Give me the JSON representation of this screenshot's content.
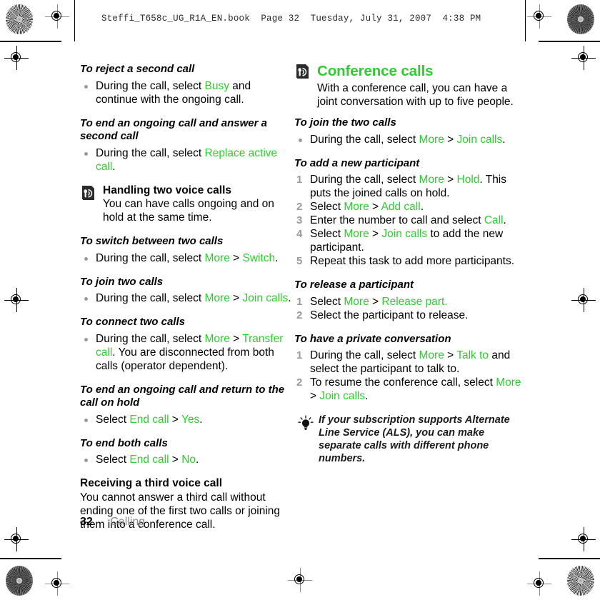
{
  "theme": {
    "accent_green": "#2ECC2E",
    "muted_gray": "#9A9A9A",
    "footer_gray": "#8A8A8A"
  },
  "header": {
    "slug": "Steffi_T658c_UG_R1A_EN.book  Page 32  Tuesday, July 31, 2007  4:38 PM"
  },
  "footer": {
    "page_number": "32",
    "chapter": "Calling"
  },
  "left_column": {
    "blocks": [
      {
        "task_heading": "To reject a second call",
        "bullets": [
          [
            {
              "t": "During the call, select ",
              "c": "black"
            },
            {
              "t": "Busy",
              "c": "green"
            },
            {
              "t": " and continue with the ongoing call.",
              "c": "black"
            }
          ]
        ]
      },
      {
        "task_heading": "To end an ongoing call and answer a second call",
        "bullets": [
          [
            {
              "t": "During the call, select ",
              "c": "black"
            },
            {
              "t": "Replace active call",
              "c": "green"
            },
            {
              "t": ".",
              "c": "black"
            }
          ]
        ]
      },
      {
        "icon": "phone-signal-icon",
        "sub_heading": "Handling two voice calls",
        "paragraph": "You can have calls ongoing and on hold at the same time."
      },
      {
        "task_heading": "To switch between two calls",
        "bullets": [
          [
            {
              "t": "During the call, select ",
              "c": "black"
            },
            {
              "t": "More",
              "c": "green"
            },
            {
              "t": " > ",
              "c": "black"
            },
            {
              "t": "Switch",
              "c": "green"
            },
            {
              "t": ".",
              "c": "black"
            }
          ]
        ]
      },
      {
        "task_heading": "To join two calls",
        "bullets": [
          [
            {
              "t": "During the call, select ",
              "c": "black"
            },
            {
              "t": "More",
              "c": "green"
            },
            {
              "t": " > ",
              "c": "black"
            },
            {
              "t": "Join calls",
              "c": "green"
            },
            {
              "t": ".",
              "c": "black"
            }
          ]
        ]
      },
      {
        "task_heading": "To connect two calls",
        "bullets": [
          [
            {
              "t": "During the call, select ",
              "c": "black"
            },
            {
              "t": "More",
              "c": "green"
            },
            {
              "t": " > ",
              "c": "black"
            },
            {
              "t": "Transfer call",
              "c": "green"
            },
            {
              "t": ". You are disconnected from both calls (operator dependent).",
              "c": "black"
            }
          ]
        ]
      },
      {
        "task_heading": "To end an ongoing call and return to the call on hold",
        "bullets": [
          [
            {
              "t": "Select ",
              "c": "black"
            },
            {
              "t": "End call",
              "c": "green"
            },
            {
              "t": " > ",
              "c": "black"
            },
            {
              "t": "Yes",
              "c": "green"
            },
            {
              "t": ".",
              "c": "black"
            }
          ]
        ]
      },
      {
        "task_heading": "To end both calls",
        "bullets": [
          [
            {
              "t": "Select ",
              "c": "black"
            },
            {
              "t": "End call",
              "c": "green"
            },
            {
              "t": " > ",
              "c": "black"
            },
            {
              "t": "No",
              "c": "green"
            },
            {
              "t": ".",
              "c": "black"
            }
          ]
        ]
      },
      {
        "sub_heading": "Receiving a third voice call",
        "paragraph": "You cannot answer a third call without ending one of the first two calls or joining them into a conference call."
      }
    ]
  },
  "right_column": {
    "section_icon": "phone-signal-icon",
    "section_title": "Conference calls",
    "section_intro": "With a conference call, you can have a joint conversation with up to five people.",
    "blocks": [
      {
        "task_heading": "To join the two calls",
        "list_type": "bullet",
        "items": [
          [
            {
              "t": "During the call, select ",
              "c": "black"
            },
            {
              "t": "More",
              "c": "green"
            },
            {
              "t": " > ",
              "c": "black"
            },
            {
              "t": "Join calls",
              "c": "green"
            },
            {
              "t": ".",
              "c": "black"
            }
          ]
        ]
      },
      {
        "task_heading": "To add a new participant",
        "list_type": "number",
        "items": [
          [
            {
              "t": "During the call, select ",
              "c": "black"
            },
            {
              "t": "More",
              "c": "green"
            },
            {
              "t": " > ",
              "c": "black"
            },
            {
              "t": "Hold",
              "c": "green"
            },
            {
              "t": ". This puts the joined calls on hold.",
              "c": "black"
            }
          ],
          [
            {
              "t": "Select ",
              "c": "black"
            },
            {
              "t": "More",
              "c": "green"
            },
            {
              "t": " > ",
              "c": "black"
            },
            {
              "t": "Add call",
              "c": "green"
            },
            {
              "t": ".",
              "c": "black"
            }
          ],
          [
            {
              "t": "Enter the number to call and select ",
              "c": "black"
            },
            {
              "t": "Call",
              "c": "green"
            },
            {
              "t": ".",
              "c": "black"
            }
          ],
          [
            {
              "t": "Select ",
              "c": "black"
            },
            {
              "t": "More",
              "c": "green"
            },
            {
              "t": " > ",
              "c": "black"
            },
            {
              "t": "Join calls",
              "c": "green"
            },
            {
              "t": " to add the new participant.",
              "c": "black"
            }
          ],
          [
            {
              "t": "Repeat this task to add more participants.",
              "c": "black"
            }
          ]
        ]
      },
      {
        "task_heading": "To release a participant",
        "list_type": "number",
        "items": [
          [
            {
              "t": "Select ",
              "c": "black"
            },
            {
              "t": "More",
              "c": "green"
            },
            {
              "t": " > ",
              "c": "black"
            },
            {
              "t": "Release part.",
              "c": "green"
            }
          ],
          [
            {
              "t": "Select the participant to release.",
              "c": "black"
            }
          ]
        ]
      },
      {
        "task_heading": "To have a private conversation",
        "list_type": "number",
        "items": [
          [
            {
              "t": "During the call, select ",
              "c": "black"
            },
            {
              "t": "More",
              "c": "green"
            },
            {
              "t": " > ",
              "c": "black"
            },
            {
              "t": "Talk to",
              "c": "green"
            },
            {
              "t": " and select the participant to talk to.",
              "c": "black"
            }
          ],
          [
            {
              "t": "To resume the conference call, select ",
              "c": "black"
            },
            {
              "t": "More",
              "c": "green"
            },
            {
              "t": " > ",
              "c": "black"
            },
            {
              "t": "Join calls",
              "c": "green"
            },
            {
              "t": ".",
              "c": "black"
            }
          ]
        ]
      }
    ],
    "tip": {
      "icon": "lightbulb-tip-icon",
      "text": "If your subscription supports Alternate Line Service (ALS), you can make separate calls with different phone numbers."
    }
  }
}
